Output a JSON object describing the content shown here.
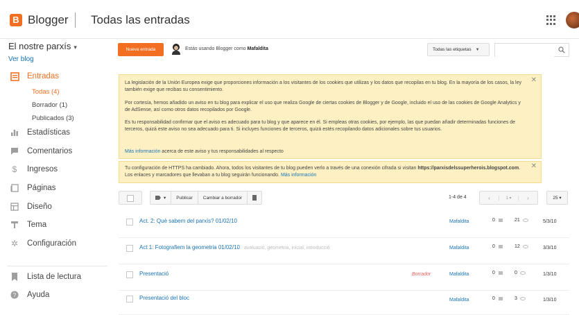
{
  "header": {
    "brand": "Blogger",
    "page_title": "Todas las entradas",
    "logo_letter": "B",
    "accent": "#f26f21"
  },
  "sidebar": {
    "blog_name": "El nostre parxís",
    "blog_caret": "▾",
    "view_blog": "Ver blog",
    "items": [
      {
        "label": "Entradas",
        "icon": "posts-icon",
        "active": true
      },
      {
        "label": "Estadísticas",
        "icon": "stats-icon"
      },
      {
        "label": "Comentarios",
        "icon": "comments-icon"
      },
      {
        "label": "Ingresos",
        "icon": "dollar-icon"
      },
      {
        "label": "Páginas",
        "icon": "pages-icon"
      },
      {
        "label": "Diseño",
        "icon": "layout-icon"
      },
      {
        "label": "Tema",
        "icon": "theme-icon"
      },
      {
        "label": "Configuración",
        "icon": "gear-icon"
      },
      {
        "label": "Lista de lectura",
        "icon": "bookmark-icon"
      },
      {
        "label": "Ayuda",
        "icon": "help-icon"
      }
    ],
    "sub_items": [
      {
        "label": "Todas (4)",
        "active": true
      },
      {
        "label": "Borrador (1)"
      },
      {
        "label": "Publicados (3)"
      }
    ]
  },
  "actions": {
    "new_post": "Nueva entrada",
    "using_prefix": "Estás usando Blogger como",
    "username": "Mafaldita",
    "labels_filter": "Todas las etiquetas",
    "search_placeholder": ""
  },
  "notices": {
    "cookies": {
      "p1": "La legislación de la Unión Europea exige que proporciones información a los visitantes de los cookies que utilizas y los datos que recopilas en tu blog. En la mayoría de los casos, la ley también exige que recibas su consentimiento.",
      "p2": "Por cortesía, hemos añadido un aviso en tu blog para explicar el uso que realiza Google de ciertas cookies de Blogger y de Google, incluido el uso de las cookies de Google Analytics y de AdSense, así como otros datos recopilados por Google.",
      "p3": "Es tu responsabilidad confirmar que el aviso es adecuado para tu blog y que aparece en él. Si empleas otras cookies, por ejemplo, las que puedan añadir determinadas funciones de terceros, quizá este aviso no sea adecuado para ti. Si incluyes funciones de terceros, quizá estés recopilando datos adicionales sobre tus usuarios.",
      "link": "Más información",
      "link_suffix": " acerca de este aviso y tus responsabilidades al respecto"
    },
    "https": {
      "line1": "Tu configuración de HTTPS ha cambiado. Ahora, todos los visitantes de tu blog pueden verlo a través de una conexión cifrada si visitan",
      "url": "https://parxisdelssuperherois.blogspot.com",
      "line2": ". Los enlaces y marcadores que llevaban a tu blog seguirán funcionando.",
      "link": "Más información"
    },
    "close": "✕"
  },
  "toolbar": {
    "tag_caret": "▾",
    "publish": "Publicar",
    "revert": "Cambiar a borrador",
    "count": "1-4 de 4",
    "prev": "‹",
    "page": "1 ▾",
    "next": "›",
    "per_page": "25 ▾"
  },
  "posts": [
    {
      "title": "Act. 2: Què sabem del parxís? 01/02/10",
      "labels": "",
      "status": "",
      "author": "Mafaldita",
      "comments": "0",
      "views": "21",
      "date": "5/3/10"
    },
    {
      "title": "Act 1: Fotografiem la geometria 01/02/10",
      "labels": "avaluació, geometria, inicial, introducció",
      "status": "",
      "author": "Mafaldita",
      "comments": "0",
      "views": "12",
      "date": "3/3/10"
    },
    {
      "title": "Presentació",
      "labels": "",
      "status": "Borrador",
      "author": "Mafaldita",
      "comments": "0",
      "views": "0",
      "date": "1/3/10"
    },
    {
      "title": "Presentació del bloc",
      "labels": "",
      "status": "",
      "author": "Mafaldita",
      "comments": "0",
      "views": "3",
      "date": "1/3/10"
    }
  ]
}
